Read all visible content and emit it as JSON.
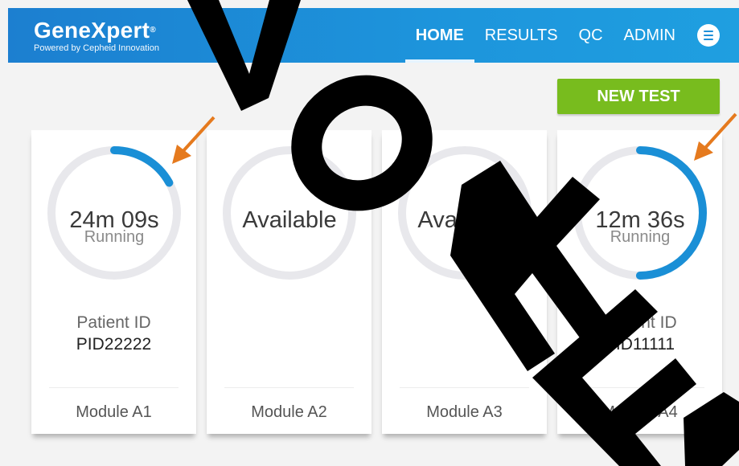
{
  "brand": {
    "name": "GeneXpert",
    "mark": "®",
    "tagline": "Powered by Cepheid Innovation"
  },
  "nav": {
    "items": [
      "HOME",
      "RESULTS",
      "QC",
      "ADMIN"
    ],
    "active": "HOME"
  },
  "new_test_label": "NEW TEST",
  "modules": [
    {
      "status": "24m 09s",
      "sub": "Running",
      "pid_label": "Patient ID",
      "pid": "PID22222",
      "name": "Module A1",
      "progress": 0.17
    },
    {
      "status": "Available",
      "name": "Module A2",
      "progress": 0
    },
    {
      "status": "Available",
      "name": "Module A3",
      "progress": 0
    },
    {
      "status": "12m 36s",
      "sub": "Running",
      "pid_label": "Patient ID",
      "pid": "PID11111",
      "name": "Module A4",
      "progress": 0.5
    }
  ],
  "watermark": "REVOKED",
  "colors": {
    "header": "#1d8fd8",
    "new_test": "#78bc1e",
    "progress": "#1a8fd6",
    "annotation_arrow": "#e57a1e"
  }
}
